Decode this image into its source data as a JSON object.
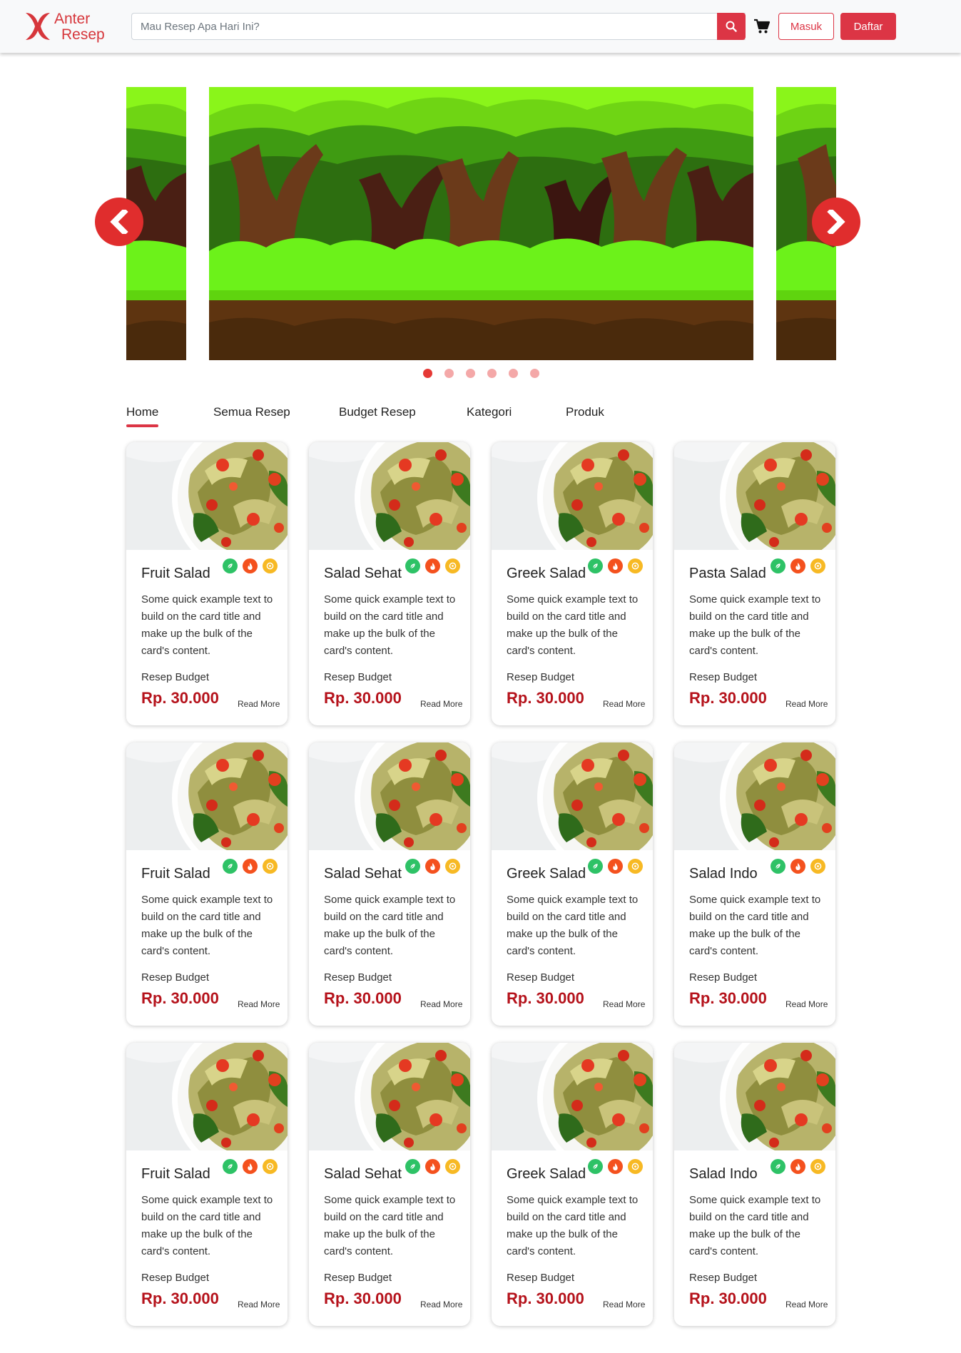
{
  "header": {
    "logo_line1": "Anter",
    "logo_line2": "Resep",
    "search_placeholder": "Mau Resep Apa Hari Ini?",
    "login_label": "Masuk",
    "register_label": "Daftar"
  },
  "carousel": {
    "slide_count": 6,
    "active_index": 0
  },
  "nav": {
    "items": [
      "Home",
      "Semua Resep",
      "Budget Resep",
      "Kategori",
      "Produk"
    ],
    "active": "Home"
  },
  "cards": [
    {
      "title": "Fruit Salad",
      "desc": "Some quick example text to build on the card title and make up the bulk of the card's content.",
      "budget_label": "Resep Budget",
      "price": "Rp. 30.000",
      "more": "Read More"
    },
    {
      "title": "Salad Sehat",
      "desc": "Some quick example text to build on the card title and make up the bulk of the card's content.",
      "budget_label": "Resep Budget",
      "price": "Rp. 30.000",
      "more": "Read More"
    },
    {
      "title": "Greek Salad",
      "desc": "Some quick example text to build on the card title and make up the bulk of the card's content.",
      "budget_label": "Resep Budget",
      "price": "Rp. 30.000",
      "more": "Read More"
    },
    {
      "title": "Pasta Salad",
      "desc": "Some quick example text to build on the card title and make up the bulk of the card's content.",
      "budget_label": "Resep Budget",
      "price": "Rp. 30.000",
      "more": "Read More"
    },
    {
      "title": "Fruit Salad",
      "desc": "Some quick example text to build on the card title and make up the bulk of the card's content.",
      "budget_label": "Resep Budget",
      "price": "Rp. 30.000",
      "more": "Read More"
    },
    {
      "title": "Salad Sehat",
      "desc": "Some quick example text to build on the card title and make up the bulk of the card's content.",
      "budget_label": "Resep Budget",
      "price": "Rp. 30.000",
      "more": "Read More"
    },
    {
      "title": "Greek Salad",
      "desc": "Some quick example text to build on the card title and make up the bulk of the card's content.",
      "budget_label": "Resep Budget",
      "price": "Rp. 30.000",
      "more": "Read More"
    },
    {
      "title": "Salad Indo",
      "desc": "Some quick example text to build on the card title and make up the bulk of the card's content.",
      "budget_label": "Resep Budget",
      "price": "Rp. 30.000",
      "more": "Read More"
    },
    {
      "title": "Fruit Salad",
      "desc": "Some quick example text to build on the card title and make up the bulk of the card's content.",
      "budget_label": "Resep Budget",
      "price": "Rp. 30.000",
      "more": "Read More"
    },
    {
      "title": "Salad Sehat",
      "desc": "Some quick example text to build on the card title and make up the bulk of the card's content.",
      "budget_label": "Resep Budget",
      "price": "Rp. 30.000",
      "more": "Read More"
    },
    {
      "title": "Greek Salad",
      "desc": "Some quick example text to build on the card title and make up the bulk of the card's content.",
      "budget_label": "Resep Budget",
      "price": "Rp. 30.000",
      "more": "Read More"
    },
    {
      "title": "Salad Indo",
      "desc": "Some quick example text to build on the card title and make up the bulk of the card's content.",
      "budget_label": "Resep Budget",
      "price": "Rp. 30.000",
      "more": "Read More"
    }
  ],
  "colors": {
    "accent": "#dc3545",
    "price": "#b5121b",
    "badge_green": "#2ec266",
    "badge_red": "#f4511e",
    "badge_yellow": "#f7b924"
  },
  "icons": [
    "search-icon",
    "cart-icon",
    "chevron-left-icon",
    "chevron-right-icon",
    "leaf-icon",
    "fire-icon",
    "coin-icon"
  ]
}
